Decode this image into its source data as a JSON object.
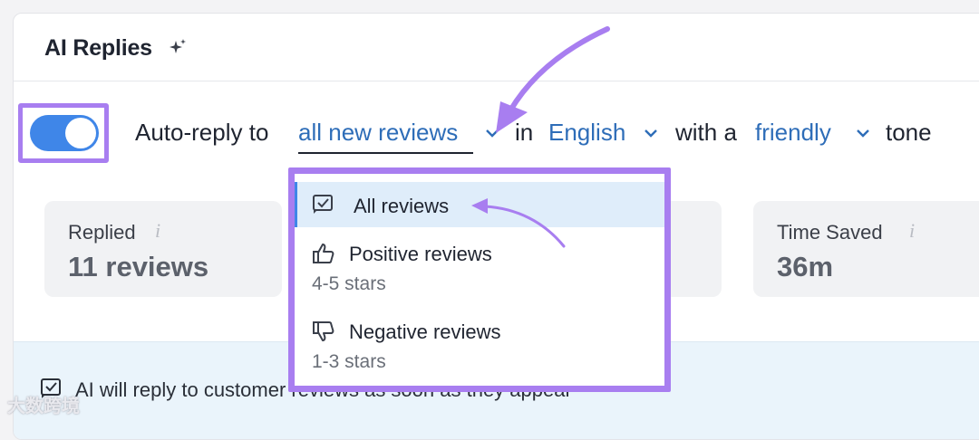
{
  "app": {
    "title": "AI Replies",
    "title_icon": "sparkle-icon"
  },
  "toggle": {
    "enabled": true,
    "color": "#3f86e8"
  },
  "sentence": {
    "prefix": "Auto-reply to",
    "review_selector": "all new reviews",
    "in_word": "in",
    "language_selector": "English",
    "with_word": "with a",
    "tone_selector": "friendly",
    "suffix": "tone"
  },
  "stats": [
    {
      "label": "Replied",
      "value": "11 reviews",
      "info_icon": "info-icon"
    },
    {
      "label": "Time Saved",
      "value": "36m",
      "info_icon": "info-icon"
    }
  ],
  "dropdown": {
    "items": [
      {
        "label": "All reviews",
        "subtitle": "",
        "icon": "checklist-icon",
        "selected": true
      },
      {
        "label": "Positive reviews",
        "subtitle": "4-5 stars",
        "icon": "thumbs-up-icon",
        "selected": false
      },
      {
        "label": "Negative reviews",
        "subtitle": "1-3 stars",
        "icon": "thumbs-down-icon",
        "selected": false
      }
    ]
  },
  "banner": {
    "text": "AI will reply to customer reviews as soon as they appear",
    "icon": "checklist-icon"
  },
  "watermark": {
    "text": "大数跨境"
  },
  "colors": {
    "highlight": "#a87ef0",
    "accent": "#3f86e8",
    "link": "#2e6db8"
  }
}
